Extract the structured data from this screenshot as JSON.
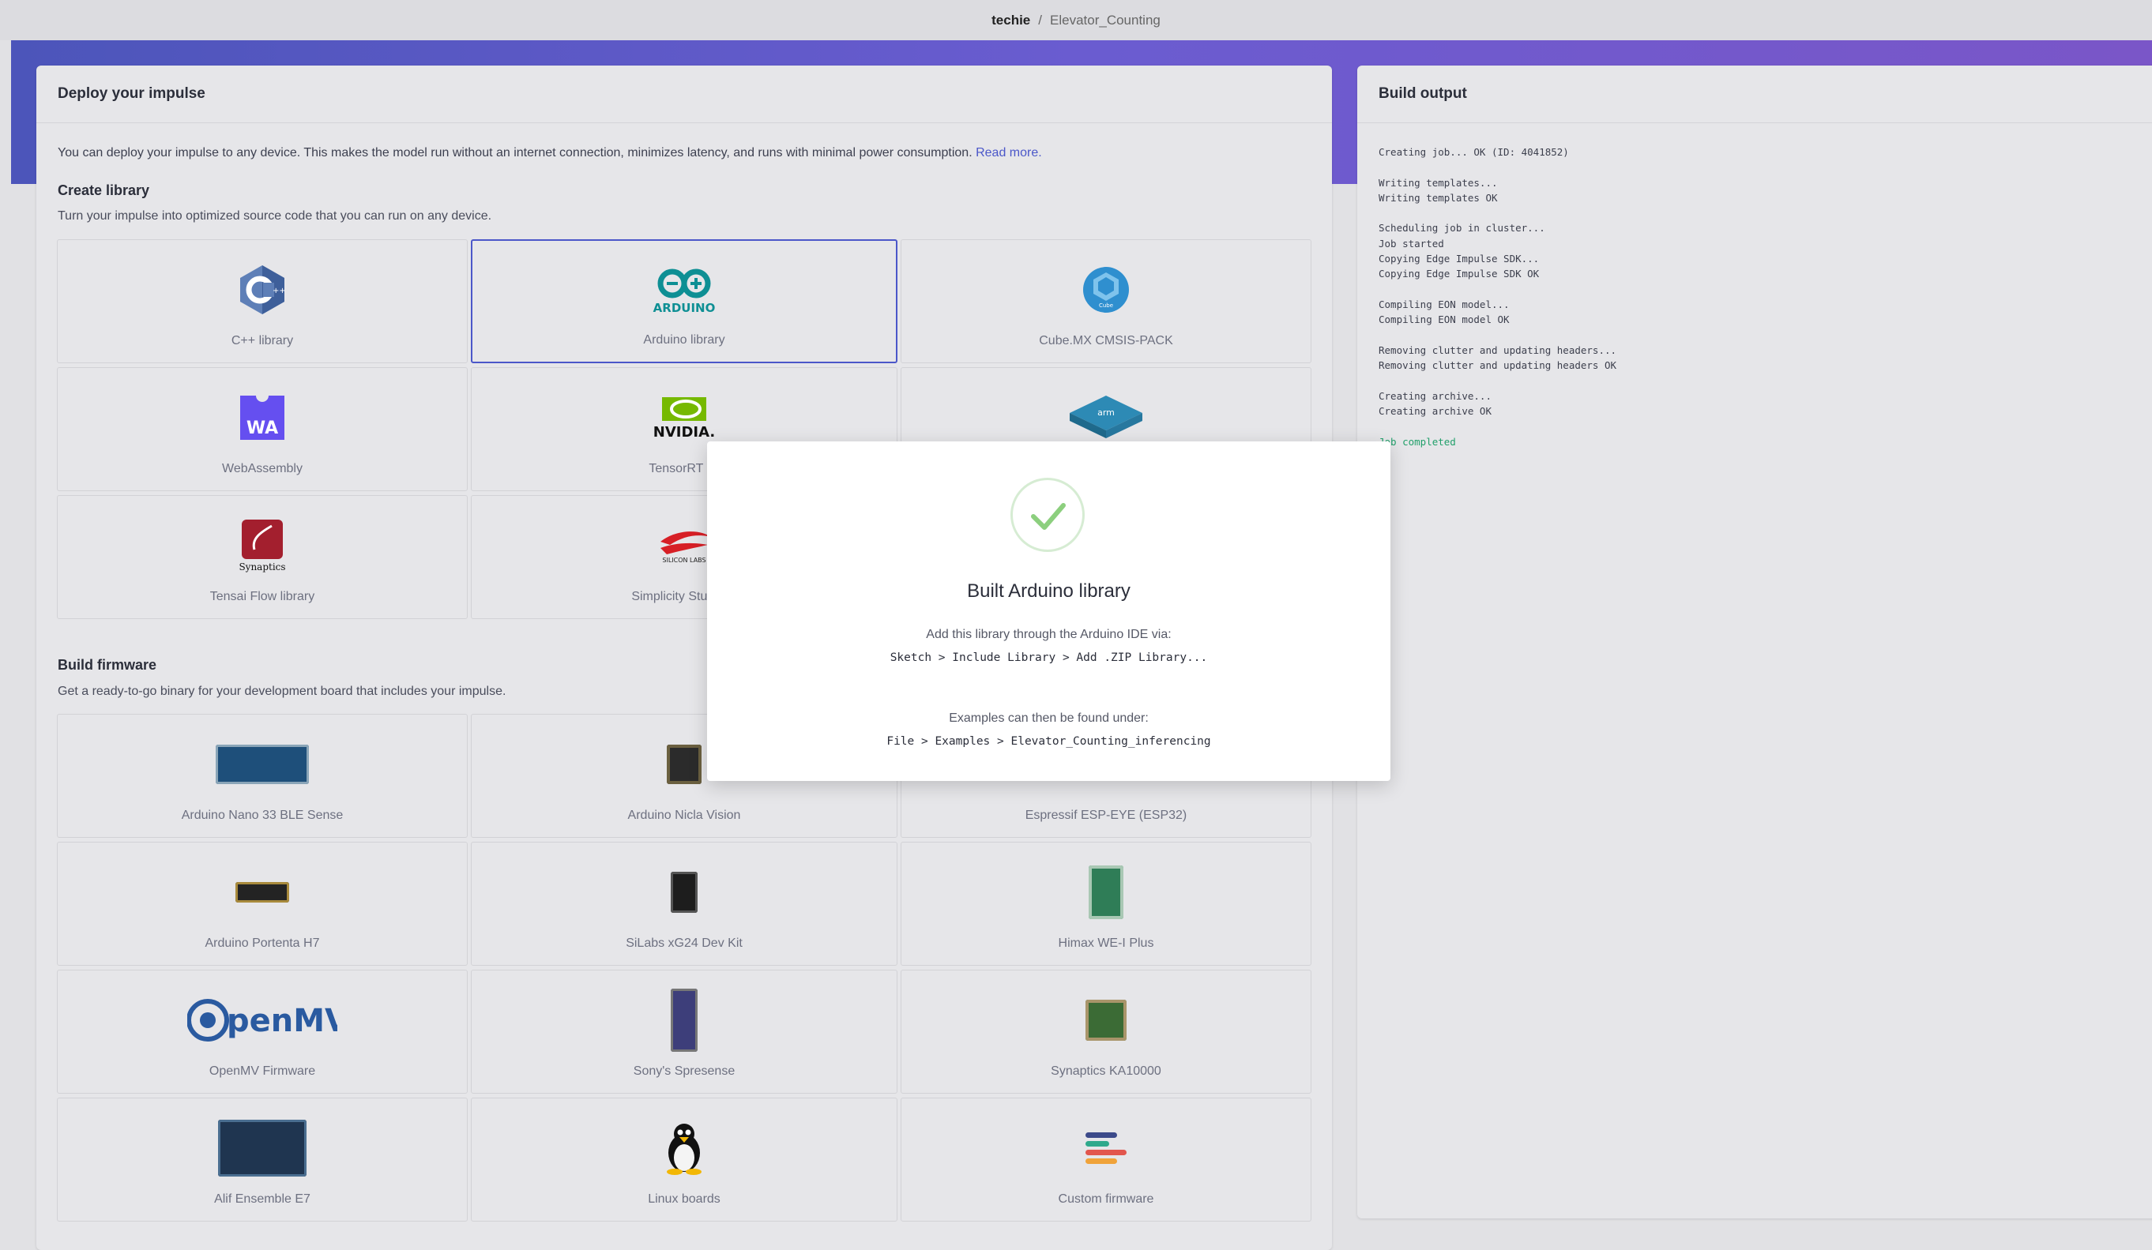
{
  "breadcrumb": {
    "owner": "techie",
    "separator": "/",
    "project": "Elevator_Counting"
  },
  "deploy": {
    "title": "Deploy your impulse",
    "intro": "You can deploy your impulse to any device. This makes the model run without an internet connection, minimizes latency, and runs with minimal power consumption.",
    "read_more": "Read more.",
    "library": {
      "title": "Create library",
      "subtitle": "Turn your impulse into optimized source code that you can run on any device.",
      "tiles": [
        {
          "label": "C++ library",
          "icon": "cpp-icon"
        },
        {
          "label": "Arduino library",
          "icon": "arduino-icon",
          "selected": true
        },
        {
          "label": "Cube.MX CMSIS-PACK",
          "icon": "stm32-cube-icon"
        },
        {
          "label": "WebAssembly",
          "icon": "webassembly-icon"
        },
        {
          "label": "TensorRT lib",
          "icon": "nvidia-icon"
        },
        {
          "label": "",
          "icon": "arm-icon"
        },
        {
          "label": "Tensai Flow library",
          "icon": "synaptics-icon"
        },
        {
          "label": "Simplicity Studio C",
          "icon": "silicon-labs-icon"
        },
        {
          "label": "",
          "icon": ""
        }
      ]
    },
    "firmware": {
      "title": "Build firmware",
      "subtitle": "Get a ready-to-go binary for your development board that includes your impulse.",
      "tiles": [
        {
          "label": "Arduino Nano 33 BLE Sense",
          "icon": "board-nano-icon"
        },
        {
          "label": "Arduino Nicla Vision",
          "icon": "board-nicla-icon"
        },
        {
          "label": "Espressif ESP-EYE (ESP32)",
          "icon": "board-esp-icon"
        },
        {
          "label": "Arduino Portenta H7",
          "icon": "board-portenta-icon"
        },
        {
          "label": "SiLabs xG24 Dev Kit",
          "icon": "board-xg24-icon"
        },
        {
          "label": "Himax WE-I Plus",
          "icon": "board-himax-icon"
        },
        {
          "label": "OpenMV Firmware",
          "icon": "openmv-logo-icon"
        },
        {
          "label": "Sony's Spresense",
          "icon": "board-spresense-icon"
        },
        {
          "label": "Synaptics KA10000",
          "icon": "board-synaptics-icon"
        },
        {
          "label": "Alif Ensemble E7",
          "icon": "board-alif-icon"
        },
        {
          "label": "Linux boards",
          "icon": "linux-tux-icon"
        },
        {
          "label": "Custom firmware",
          "icon": "custom-firmware-icon"
        }
      ]
    }
  },
  "build_output": {
    "title": "Build output",
    "lines": [
      "Creating job... OK (ID: 4041852)",
      "",
      "Writing templates...",
      "Writing templates OK",
      "",
      "Scheduling job in cluster...",
      "Job started",
      "Copying Edge Impulse SDK...",
      "Copying Edge Impulse SDK OK",
      "",
      "Compiling EON model...",
      "Compiling EON model OK",
      "",
      "Removing clutter and updating headers...",
      "Removing clutter and updating headers OK",
      "",
      "Creating archive...",
      "Creating archive OK",
      ""
    ],
    "final_line": "Job completed"
  },
  "modal": {
    "title": "Built Arduino library",
    "instruction": "Add this library through the Arduino IDE via:",
    "menu_path": "Sketch > Include Library > Add .ZIP Library...",
    "examples_text": "Examples can then be found under:",
    "examples_path": "File > Examples > Elevator_Counting_inferencing"
  },
  "colors": {
    "accent": "#4b57c9",
    "success": "#22a06b",
    "hero_start": "#4c55ba",
    "hero_end": "#7a56c8"
  }
}
